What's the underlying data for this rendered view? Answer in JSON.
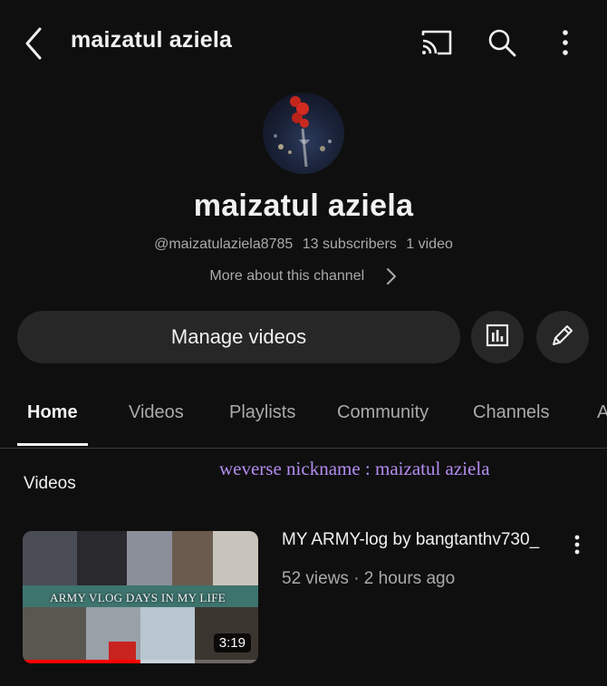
{
  "header": {
    "title": "maizatul aziela",
    "icons": [
      "back-arrow-icon",
      "cast-icon",
      "search-icon",
      "more-vertical-icon"
    ]
  },
  "channel": {
    "name": "maizatul aziela",
    "handle": "@maizatulaziela8785",
    "subscribers": "13 subscribers",
    "video_count": "1 video",
    "more_about": "More about this channel"
  },
  "actions": {
    "manage_videos": "Manage videos",
    "analytics_icon": "analytics-icon",
    "edit_icon": "pencil-icon"
  },
  "tabs": [
    {
      "label": "Home",
      "active": true
    },
    {
      "label": "Videos",
      "active": false
    },
    {
      "label": "Playlists",
      "active": false
    },
    {
      "label": "Community",
      "active": false
    },
    {
      "label": "Channels",
      "active": false
    },
    {
      "label": "A",
      "active": false
    }
  ],
  "section": {
    "label": "Videos",
    "overlay_note": "weverse nickname : maizatul aziela"
  },
  "video": {
    "title": "MY ARMY-log by bangtanthv730_",
    "meta": "52 views · 2 hours ago",
    "thumbnail_text": "ARMY VLOG DAYS IN MY LIFE",
    "duration": "3:19",
    "watch_progress": 0.5
  },
  "colors": {
    "background": "#0f0f0f",
    "surface": "#272727",
    "text_primary": "#f1f1f1",
    "text_secondary": "#aaaaaa",
    "overlay_text": "#b48cf0",
    "progress": "#ff0000"
  }
}
